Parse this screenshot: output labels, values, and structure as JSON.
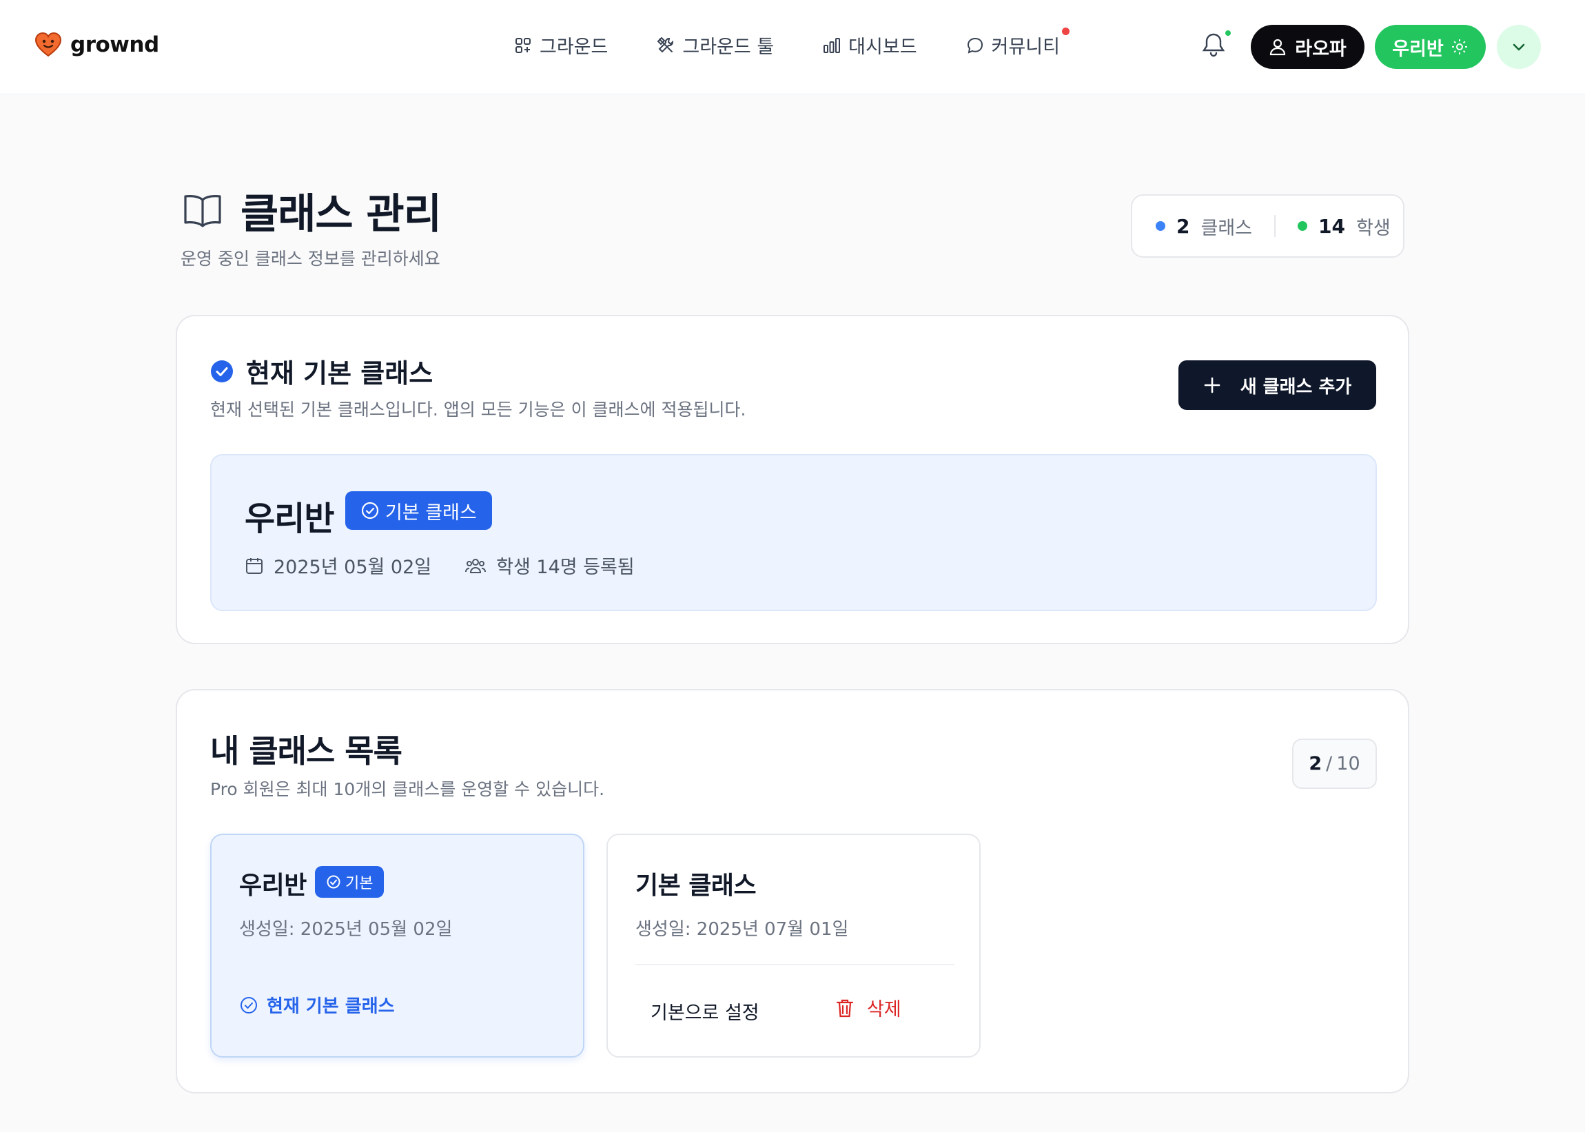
{
  "header": {
    "brand": "grownd",
    "nav": [
      {
        "label": "그라운드"
      },
      {
        "label": "그라운드 툴"
      },
      {
        "label": "대시보드"
      },
      {
        "label": "커뮤니티"
      }
    ],
    "user_button": "라오파",
    "class_button": "우리반"
  },
  "page": {
    "title": "클래스 관리",
    "subtitle": "운영 중인 클래스 정보를 관리하세요",
    "stats": {
      "class_count": "2",
      "class_label": "클래스",
      "student_count": "14",
      "student_label": "학생"
    }
  },
  "current_class": {
    "section_title": "현재 기본 클래스",
    "section_desc": "현재 선택된 기본 클래스입니다. 앱의 모든 기능은 이 클래스에 적용됩니다.",
    "add_button": "새 클래스 추가",
    "name": "우리반",
    "badge": "기본 클래스",
    "date": "2025년 05월 02일",
    "students": "학생 14명 등록됨"
  },
  "class_list": {
    "title": "내 클래스 목록",
    "desc": "Pro 회원은 최대 10개의 클래스를 운영할 수 있습니다.",
    "count_current": "2",
    "count_sep": "/",
    "count_max": "10",
    "items": [
      {
        "name": "우리반",
        "badge": "기본",
        "created": "생성일: 2025년 05월 02일",
        "status": "현재 기본 클래스"
      },
      {
        "name": "기본 클래스",
        "created": "생성일: 2025년 07월 01일",
        "set_default": "기본으로 설정",
        "delete": "삭제"
      }
    ]
  },
  "colors": {
    "accent_blue": "#2563eb",
    "accent_green": "#22c55e",
    "danger": "#dc2626",
    "dark": "#0f172a"
  }
}
